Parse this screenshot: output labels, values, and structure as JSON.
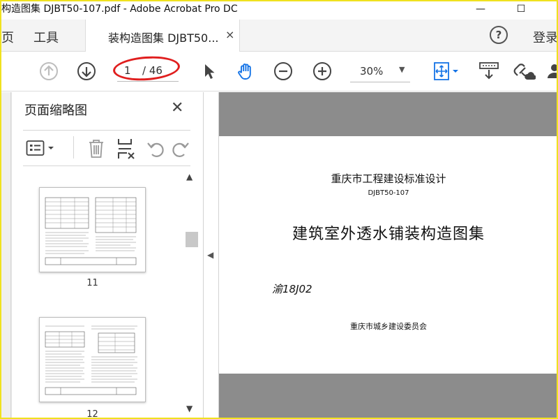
{
  "window": {
    "title": "构造图集 DJBT50-107.pdf - Adobe Acrobat Pro DC",
    "minimize": "—",
    "maximize": "☐"
  },
  "tabs": {
    "home_partial": "页",
    "tools": "工具",
    "document_tab": "装构造图集 DJBT50...",
    "close": "×",
    "help": "?",
    "login": "登录"
  },
  "toolbar": {
    "current_page": "1",
    "total_pages": "/ 46",
    "zoom": "30%",
    "zoom_caret": "▼"
  },
  "panel": {
    "title": "页面缩略图",
    "close": "✕",
    "thumbnails": [
      {
        "label": "11"
      },
      {
        "label": "12"
      }
    ]
  },
  "document": {
    "line1": "重庆市工程建设标准设计",
    "line2": "DJBT50-107",
    "main_title": "建筑室外透水铺装构造图集",
    "code": "渝18J02",
    "issuer": "重庆市城乡建设委员会"
  },
  "colors": {
    "annotation_oval": "#e01e1e",
    "accent_blue": "#1473e6",
    "doc_bg": "#8c8c8c",
    "screenshot_border": "#f0e21f"
  }
}
